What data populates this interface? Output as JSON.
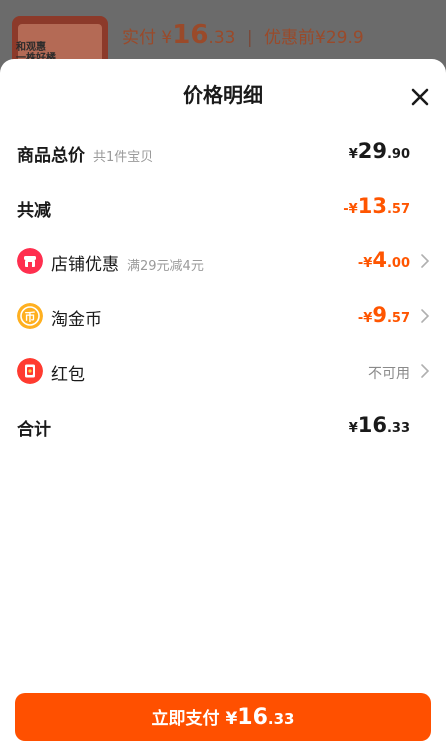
{
  "background": {
    "thumb_text": "和观惠\n一株好橘",
    "price_prefix": "实付",
    "price_yen": "¥",
    "price_int": "16",
    "price_dec": ".33",
    "separator": "|",
    "original_label": "优惠前",
    "original_price": "¥29.9"
  },
  "sheet": {
    "title": "价格明细",
    "close_icon": "close-icon"
  },
  "rows": {
    "total": {
      "label": "商品总价",
      "sub": "共1件宝贝",
      "yen": "¥",
      "int": "29",
      "dec": ".90"
    },
    "discount": {
      "label": "共减",
      "prefix": "-¥",
      "int": "13",
      "dec": ".57"
    },
    "shop": {
      "label": "店铺优惠",
      "sub": "满29元减4元",
      "prefix": "-¥",
      "int": "4",
      "dec": ".00",
      "icon": "shop-icon"
    },
    "coin": {
      "label": "淘金币",
      "prefix": "-¥",
      "int": "9",
      "dec": ".57",
      "icon": "coin-icon"
    },
    "redpacket": {
      "label": "红包",
      "status": "不可用",
      "icon": "red-packet-icon"
    },
    "sum": {
      "label": "合计",
      "yen": "¥",
      "int": "16",
      "dec": ".33"
    }
  },
  "pay_button": {
    "label": "立即支付",
    "yen": "¥",
    "int": "16",
    "dec": ".33"
  },
  "colors": {
    "accent": "#ff5500",
    "button": "#ff5000",
    "shop_icon": "#ff2f4f",
    "coin_icon": "#ffb020",
    "redpacket_icon": "#ff3b30"
  }
}
